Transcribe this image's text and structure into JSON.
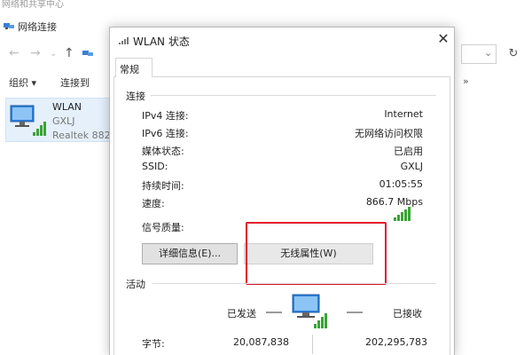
{
  "background": {
    "title_partial": "网络和共享中心",
    "header_title": "网络连接",
    "toolbar": {
      "organize": "组织 ▾",
      "connect_to": "连接到"
    },
    "more": "»",
    "refresh": "↻",
    "address_chevron": "⌄",
    "adapter": {
      "name": "WLAN",
      "network": "GXLJ",
      "device": "Realtek 882"
    }
  },
  "dialog": {
    "title": "WLAN 状态",
    "close": "✕",
    "tab": "常规",
    "connection_section": "连接",
    "rows": [
      {
        "label": "IPv4 连接:",
        "value": "Internet"
      },
      {
        "label": "IPv6 连接:",
        "value": "无网络访问权限"
      },
      {
        "label": "媒体状态:",
        "value": "已启用"
      },
      {
        "label": "SSID:",
        "value": "GXLJ"
      },
      {
        "label": "持续时间:",
        "value": "01:05:55"
      },
      {
        "label": "速度:",
        "value": "866.7 Mbps"
      }
    ],
    "signal_label": "信号质量:",
    "details_button": "详细信息(E)...",
    "wireless_button": "无线属性(W)",
    "activity_section": "活动",
    "sent_label": "已发送",
    "received_label": "已接收",
    "bytes_label": "字节:",
    "bytes_sent": "20,087,838",
    "bytes_received": "202,295,783"
  },
  "colors": {
    "highlight": "#e0182d",
    "signal": "#3aa335",
    "selection": "#e5f0fb"
  }
}
